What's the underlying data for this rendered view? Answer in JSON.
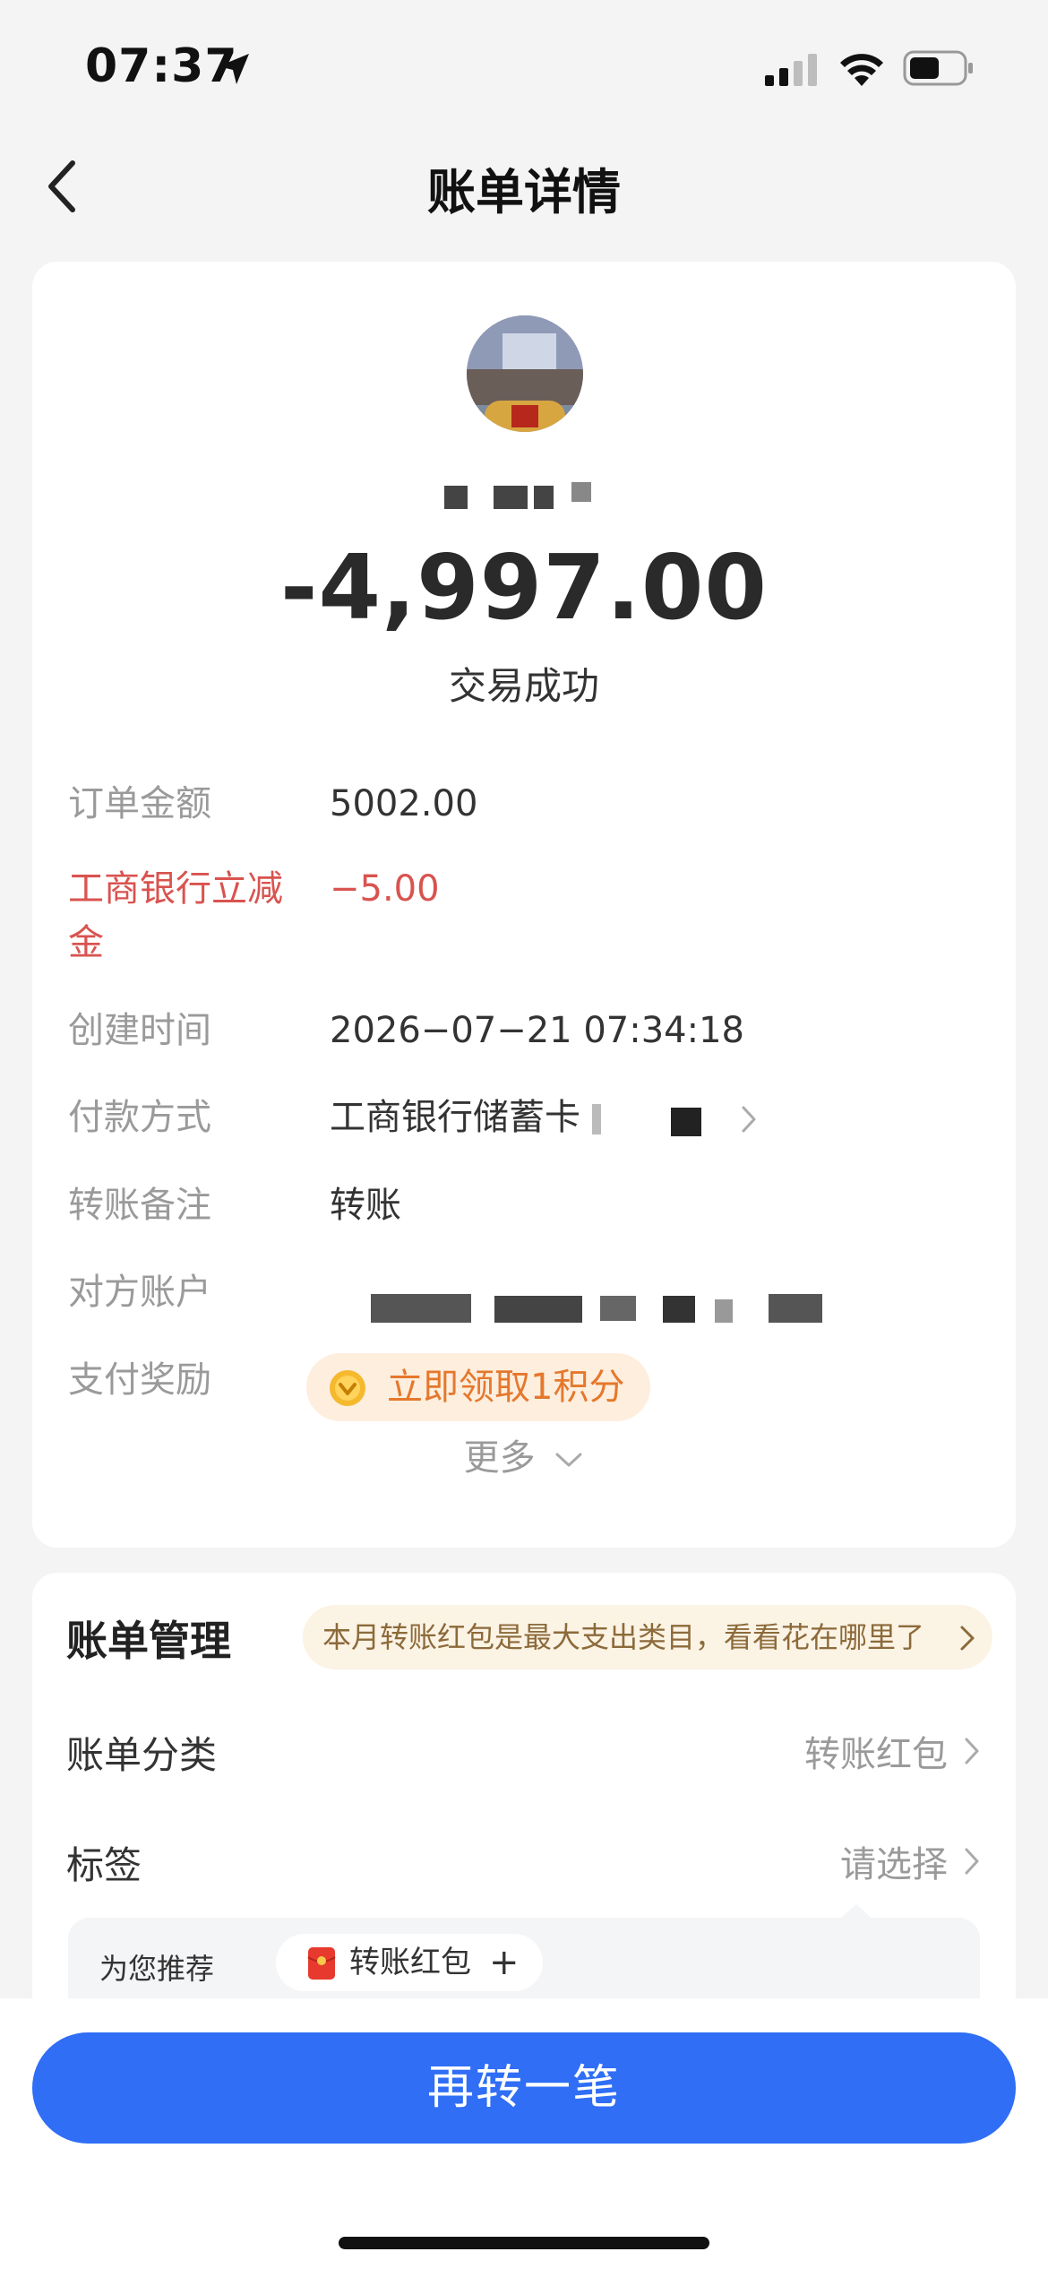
{
  "status_bar": {
    "time": "07:37"
  },
  "nav": {
    "title": "账单详情"
  },
  "transaction": {
    "amount": "-4,997.00",
    "status": "交易成功"
  },
  "details": {
    "order_amount_label": "订单金额",
    "order_amount_value": "5002.00",
    "discount_label_line1": "工商银行立减",
    "discount_label_line2": "金",
    "discount_value": "−5.00",
    "created_label": "创建时间",
    "created_value": "2026−07−21 07:34:18",
    "payment_label": "付款方式",
    "payment_value": "工商银行储蓄卡",
    "note_label": "转账备注",
    "note_value": "转账",
    "account_label": "对方账户",
    "reward_label": "支付奖励",
    "reward_text": "立即领取1积分",
    "more": "更多"
  },
  "management": {
    "title": "账单管理",
    "insight": "本月转账红包是最大支出类目，看看花在哪里了",
    "category_label": "账单分类",
    "category_value": "转账红包",
    "tag_label": "标签",
    "tag_value": "请选择",
    "recommend_label": "为您推荐",
    "recommend_tag": "转账红包",
    "recommend_plus": "+"
  },
  "actions": {
    "primary": "再转一笔"
  },
  "colors": {
    "primary_blue": "#2f6ef5",
    "discount_red": "#d9534f",
    "reward_orange": "#e5782c",
    "insight_brown": "#8c6a3a"
  }
}
